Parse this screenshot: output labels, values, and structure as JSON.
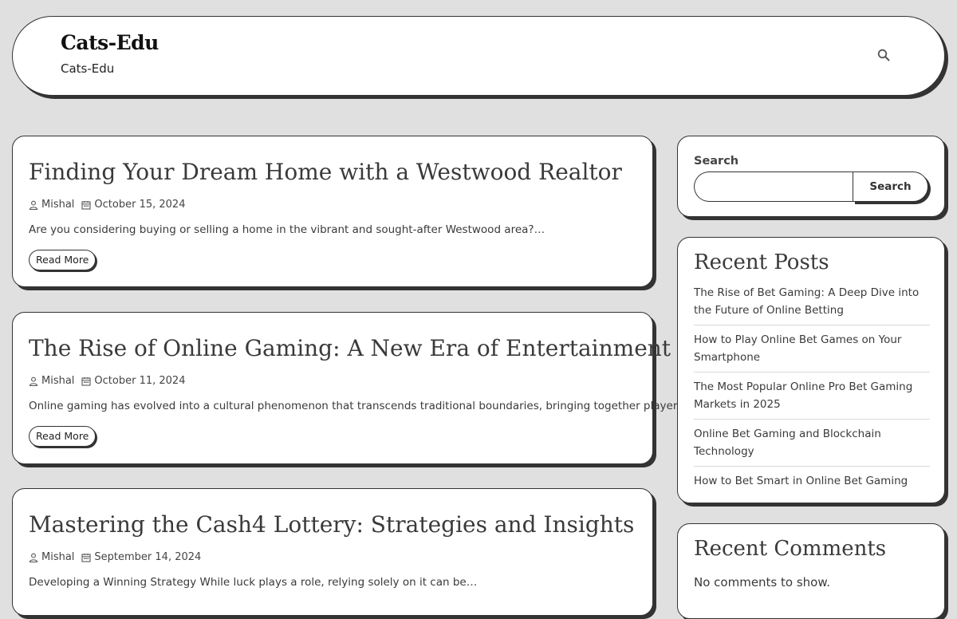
{
  "header": {
    "site_title": "Cats-Edu",
    "tagline": "Cats-Edu",
    "search_icon": "search-icon"
  },
  "posts": [
    {
      "title": "Finding Your Dream Home with a Westwood Realtor",
      "author": "Mishal",
      "date": "October 15, 2024",
      "excerpt": "Are you considering buying or selling a home in the vibrant and sought-after Westwood area?…",
      "read_more": "Read More"
    },
    {
      "title": "The Rise of Online Gaming: A New Era of Entertainment",
      "author": "Mishal",
      "date": "October 11, 2024",
      "excerpt": "Online gaming has evolved into a cultural phenomenon that transcends traditional boundaries, bringing together players…",
      "read_more": "Read More"
    },
    {
      "title": "Mastering the Cash4 Lottery: Strategies and Insights",
      "author": "Mishal",
      "date": "September 14, 2024",
      "excerpt": "Developing a Winning Strategy While luck plays a role, relying solely on it can be…",
      "read_more": "Read More"
    }
  ],
  "sidebar": {
    "search": {
      "label": "Search",
      "placeholder": "",
      "button_label": "Search"
    },
    "recent_posts": {
      "title": "Recent Posts",
      "items": [
        "The Rise of Bet Gaming: A Deep Dive into the Future of Online Betting",
        "How to Play Online Bet Games on Your Smartphone",
        "The Most Popular Online Pro Bet Gaming Markets in 2025",
        "Online Bet Gaming and Blockchain Technology",
        "How to Bet Smart in Online Bet Gaming"
      ]
    },
    "recent_comments": {
      "title": "Recent Comments",
      "empty_text": "No comments to show."
    }
  },
  "icons": {
    "author": "user-icon",
    "date": "calendar-icon"
  },
  "colors": {
    "background": "#e0e0e0",
    "card": "#ffffff",
    "border": "#333333",
    "text": "#3a3a3a"
  }
}
